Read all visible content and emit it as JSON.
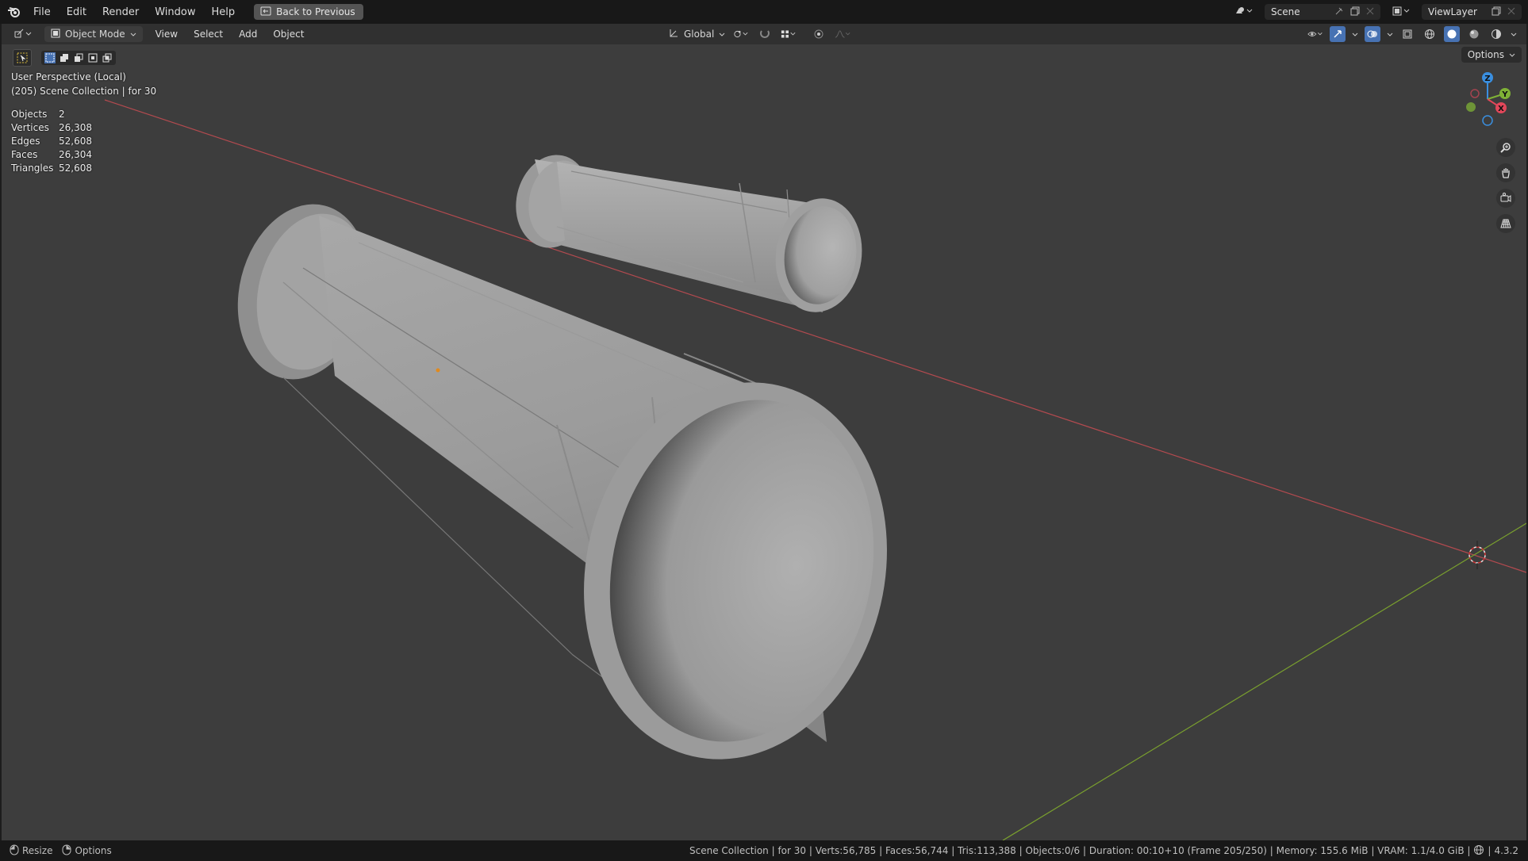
{
  "topbar": {
    "menu": [
      "File",
      "Edit",
      "Render",
      "Window",
      "Help"
    ],
    "back_button": "Back to Previous",
    "scene_name": "Scene",
    "view_layer_name": "ViewLayer"
  },
  "viewport_header": {
    "mode": "Object Mode",
    "menus": [
      "View",
      "Select",
      "Add",
      "Object"
    ],
    "transform_orientation": "Global"
  },
  "overlay": {
    "view_name": "User Perspective (Local)",
    "collection_line": "(205) Scene Collection | for 30",
    "stats": [
      {
        "label": "Objects",
        "value": "2"
      },
      {
        "label": "Vertices",
        "value": "26,308"
      },
      {
        "label": "Edges",
        "value": "52,608"
      },
      {
        "label": "Faces",
        "value": "26,304"
      },
      {
        "label": "Triangles",
        "value": "52,608"
      }
    ],
    "options_label": "Options"
  },
  "gizmo": {
    "z": "Z",
    "y": "Y",
    "x": "X"
  },
  "statusbar": {
    "hints": [
      "Resize",
      "Options"
    ],
    "info": "Scene Collection | for 30 | Verts:56,785 | Faces:56,744 | Tris:113,388 | Objects:0/6 | Duration: 00:10+10 (Frame 205/250) | Memory: 155.6 MiB | VRAM: 1.1/4.0 GiB |",
    "version": "4.3.2"
  },
  "colors": {
    "x_axis": "#b34a4f",
    "y_axis": "#7aa02e",
    "gizmo_x": "#e2475a",
    "gizmo_y": "#7fb236",
    "gizmo_z": "#3a8fe0",
    "accent": "#4772b3"
  }
}
